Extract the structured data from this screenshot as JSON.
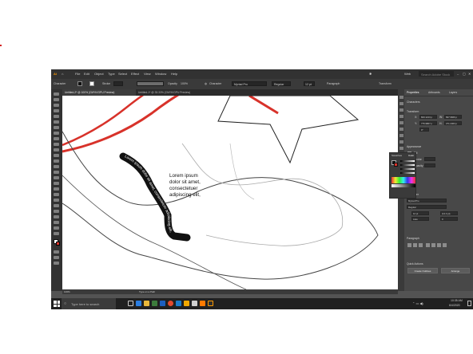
{
  "menu": {
    "items": [
      "File",
      "Edit",
      "Object",
      "Type",
      "Select",
      "Effect",
      "View",
      "Window",
      "Help"
    ],
    "workspace": "Web",
    "search_placeholder": "Search Adobe Stock"
  },
  "control_bar": {
    "character_label": "Character",
    "stroke_label": "Stroke",
    "opacity_label": "Opacity",
    "opacity_value": "100%",
    "char_label2": "Character",
    "font": "Myriad Pro",
    "style": "Regular",
    "size": "12 pt",
    "paragraph": "Paragraph",
    "transform": "Transform"
  },
  "tabs": [
    {
      "label": "Untitled-2* @ 100% (CMYK/GPU Preview)"
    },
    {
      "label": "Untitled-1* @ 33.33% (CMYK/GPU Preview)"
    }
  ],
  "canvas": {
    "text_block": [
      "Lorem ipsum",
      "dolor sit amet,",
      "consectetuer",
      "adipiscing elit,"
    ],
    "path_text": "Lorem ipsum dolor sit amet, consectetuer adipiscing elit,"
  },
  "status": {
    "zoom": "100%",
    "tool": "Type on a Path"
  },
  "properties": {
    "tabs": [
      "Properties",
      "Artboards",
      "Layers"
    ],
    "character_section": "Characters",
    "transform_section": "Transform",
    "x_label": "X:",
    "x_value": "843.1213 p",
    "y_label": "Y:",
    "y_value": "775.9867 p",
    "w_label": "W:",
    "w_value": "697.9666 p",
    "h_label": "H:",
    "h_value": "271.2463 p",
    "angle": "0°",
    "appearance_section": "Appearance",
    "fill_label": "Fill",
    "stroke_label": "Stroke",
    "opacity_label": "Opacity",
    "character_title": "Character",
    "font": "Myriad Pro",
    "style": "Regular",
    "size": "12 pt",
    "leading": "(14.4 pt)",
    "tracking": "Auto",
    "kerning": "0",
    "paragraph_section": "Paragraph",
    "quick_actions": "Quick Actions",
    "create_outlines": "Create Outlines",
    "arrange": "Arrange"
  },
  "swatch_panel": {
    "tab1": "Swatches",
    "tab2": "Color"
  },
  "taskbar": {
    "search_placeholder": "Type here to search",
    "time": "10:35 AM",
    "date": "6/4/2020"
  },
  "colors": {
    "accent_red": "#d8322a",
    "dark_ui": "#323232",
    "panel": "#484848"
  }
}
